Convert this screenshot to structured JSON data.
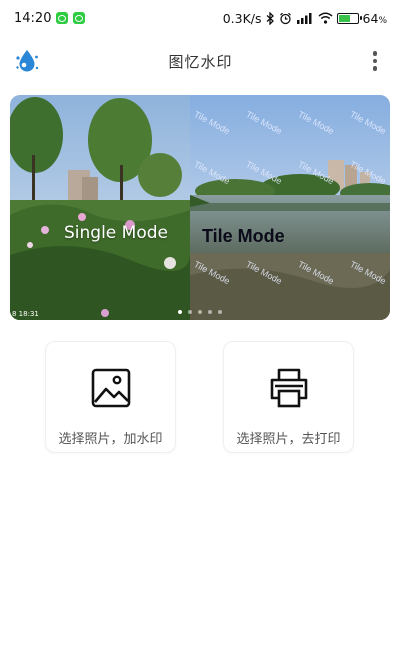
{
  "status_bar": {
    "time": "14:20",
    "network_speed": "0.3K/s",
    "battery_percent": "64",
    "battery_unit": "%",
    "battery_level": 0.64,
    "icons": [
      "wechat-icon",
      "wechat-icon",
      "bluetooth-icon",
      "alarm-icon",
      "signal-icon",
      "wifi-icon",
      "battery-icon"
    ]
  },
  "app_bar": {
    "title": "图忆水印",
    "logo_icon": "water-drop-logo-icon",
    "menu_icon": "more-vertical-icon"
  },
  "banner": {
    "single_mode_label": "Single Mode",
    "tile_mode_label": "Tile Mode",
    "watermark_text": "Tile Mode",
    "photo_timestamp": "8 18:31",
    "page_count": 5,
    "active_page": 0
  },
  "actions": {
    "add_watermark_label": "选择照片，加水印",
    "print_label": "选择照片，去打印",
    "add_watermark_icon": "image-icon",
    "print_icon": "printer-icon"
  },
  "colors": {
    "logo_blue": "#2a86d6",
    "accent_green": "#2ecc40",
    "card_border": "#efefef"
  }
}
